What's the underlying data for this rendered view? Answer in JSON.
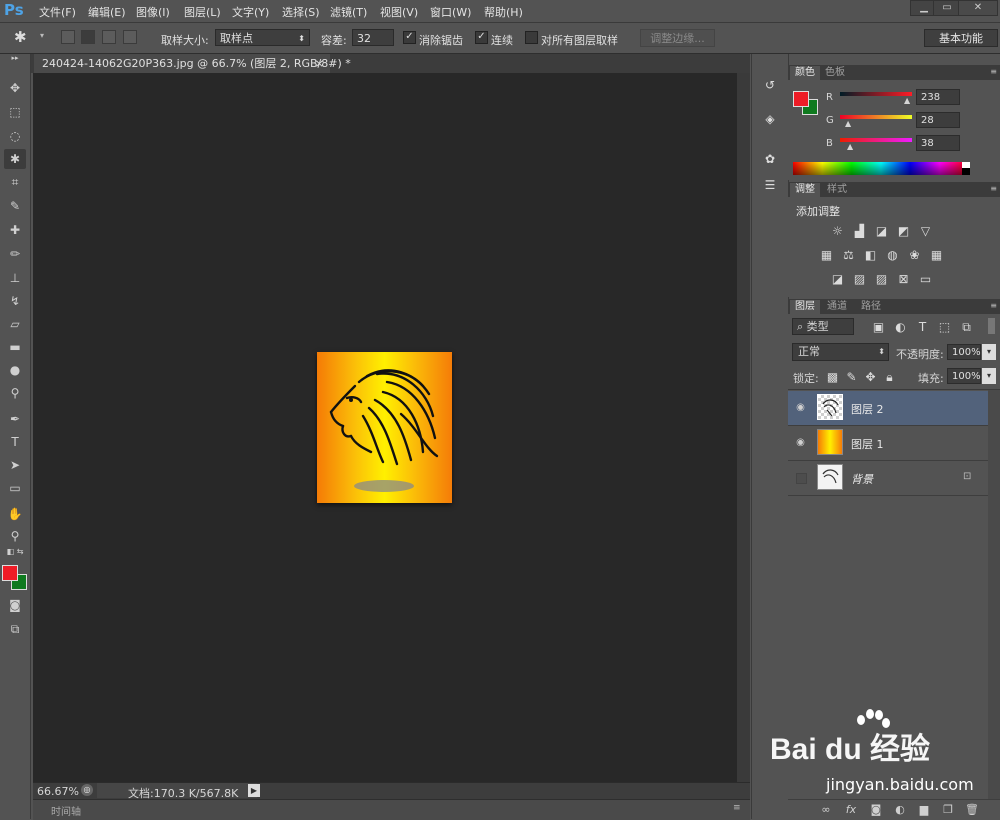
{
  "app": {
    "logo": "Ps"
  },
  "menu": [
    "文件(F)",
    "编辑(E)",
    "图像(I)",
    "图层(L)",
    "文字(Y)",
    "选择(S)",
    "滤镜(T)",
    "视图(V)",
    "窗口(W)",
    "帮助(H)"
  ],
  "window_controls": {
    "minimize": "▁",
    "restore": "▭",
    "close": "✕"
  },
  "options": {
    "sample_size_label": "取样大小:",
    "sample_size_value": "取样点",
    "tolerance_label": "容差:",
    "tolerance_value": "32",
    "anti_alias_label": "消除锯齿",
    "anti_alias_checked": "✓",
    "contiguous_label": "连续",
    "contiguous_checked": "✓",
    "all_layers_label": "对所有图层取样",
    "refine_edge_label": "调整边缘...",
    "workspace_label": "基本功能"
  },
  "document": {
    "tab_title": "240424-14062G20P363.jpg @ 66.7% (图层 2, RGB/8#) *",
    "tab_close": "×",
    "zoom": "66.67%",
    "doc_size": "文档:170.3 K/567.8K",
    "timeline_label": "时间轴"
  },
  "color_panel": {
    "tabs": [
      "颜色",
      "色板"
    ],
    "channels": [
      {
        "label": "R",
        "value": "238"
      },
      {
        "label": "G",
        "value": "28"
      },
      {
        "label": "B",
        "value": "38"
      }
    ],
    "foreground": "#ee1c26",
    "background": "#0f7a1f"
  },
  "adjust_panel": {
    "tabs": [
      "调整",
      "样式"
    ],
    "title": "添加调整"
  },
  "layers_panel": {
    "tabs": [
      "图层",
      "通道",
      "路径"
    ],
    "filter_kind": "类型",
    "blend_mode": "正常",
    "opacity_label": "不透明度:",
    "opacity_value": "100%",
    "lock_label": "锁定:",
    "fill_label": "填充:",
    "fill_value": "100%",
    "layers": [
      {
        "name": "图层 2",
        "visible": true,
        "selected": true
      },
      {
        "name": "图层 1",
        "visible": true,
        "selected": false
      },
      {
        "name": "背景",
        "visible": false,
        "selected": false
      }
    ]
  },
  "watermark": {
    "brand": "Bai du 经验",
    "url": "jingyan.baidu.com"
  }
}
